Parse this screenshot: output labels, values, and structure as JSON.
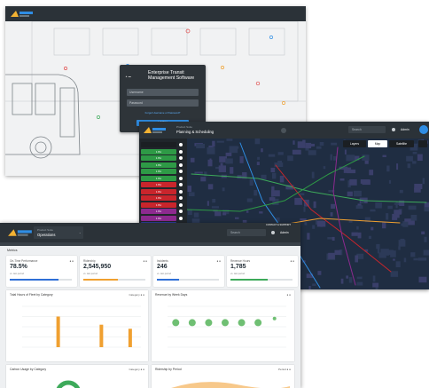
{
  "login": {
    "app_title": "Enterprise Transit Management Software",
    "username_placeholder": "Username",
    "password_placeholder": "Password",
    "forgot_label": "Forgot Username or Password?",
    "login_button": "LOGIN"
  },
  "map": {
    "breadcrumb": "Product Suite",
    "module": "Planning & Scheduling",
    "search_placeholder": "Search",
    "user_label": "Admin",
    "tabs": [
      "Layers",
      "Map",
      "Satellite"
    ],
    "routes": [
      {
        "label": "",
        "color": "#1b1f23"
      },
      {
        "label": "1 B1",
        "color": "#2e9a46"
      },
      {
        "label": "1 B1",
        "color": "#2e9a46"
      },
      {
        "label": "1 B1",
        "color": "#2e9a46"
      },
      {
        "label": "1 B1",
        "color": "#2e9a46"
      },
      {
        "label": "1 B1",
        "color": "#2e9a46"
      },
      {
        "label": "1 B1",
        "color": "#c9252c"
      },
      {
        "label": "1 B1",
        "color": "#c9252c"
      },
      {
        "label": "1 B1",
        "color": "#c9252c"
      },
      {
        "label": "1 B1",
        "color": "#c9252c"
      },
      {
        "label": "1 B1",
        "color": "#8d2a8f"
      },
      {
        "label": "1 B1",
        "color": "#8d2a8f"
      },
      {
        "label": "1 B1",
        "color": "#2d3f9e"
      },
      {
        "label": "1 B1",
        "color": "#2d3f9e"
      }
    ]
  },
  "dash": {
    "breadcrumb": "Product Suite",
    "module": "Operations",
    "search_placeholder": "Search",
    "user_label": "Admin",
    "contact": "CONTACT & SUPPORT",
    "page_title": "Metrics",
    "kpis": [
      {
        "label": "On-Time Performance",
        "value": "78.5%",
        "sub": "vs. last period",
        "accent": "#2f6fd6",
        "fill": 0.78
      },
      {
        "label": "Ridership",
        "value": "2,545,950",
        "sub": "vs. last period",
        "accent": "#f0a030",
        "fill": 0.55
      },
      {
        "label": "Incidents",
        "value": "246",
        "sub": "vs. last period",
        "accent": "#2f6fd6",
        "fill": 0.35
      },
      {
        "label": "Revenue Hours",
        "value": "1,785",
        "sub": "vs. last period",
        "accent": "#3daa5a",
        "fill": 0.6
      }
    ],
    "panels": {
      "fleet_title": "Total Hours of Fleet by Category",
      "fleet_ctrl": "Category",
      "revenue_title": "Revenue by Week Days",
      "fuel_title": "Carbon Usage by Category",
      "fuel_ctrl": "Category",
      "ridership_title": "Ridership by Period",
      "ridership_ctrl": "Period"
    }
  },
  "chart_data": [
    {
      "type": "bar",
      "title": "Total Hours of Fleet by Category",
      "categories": [
        "A",
        "B",
        "C",
        "D",
        "E",
        "F",
        "G",
        "H"
      ],
      "series": [
        {
          "name": "",
          "values": [
            0,
            0,
            75,
            0,
            0,
            55,
            0,
            45
          ]
        }
      ]
    },
    {
      "type": "scatter",
      "title": "Revenue by Week Days",
      "x": [
        "Mon",
        "Tue",
        "Wed",
        "Thu",
        "Fri",
        "Sat",
        "Sun"
      ],
      "series": [
        {
          "name": "",
          "values": [
            60,
            60,
            60,
            60,
            60,
            60,
            70
          ]
        }
      ]
    }
  ]
}
